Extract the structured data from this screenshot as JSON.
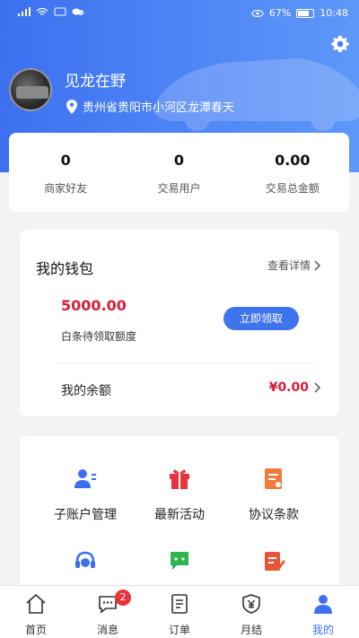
{
  "status_bar": {
    "battery": "67%",
    "time": "10:48"
  },
  "profile": {
    "name": "见龙在野",
    "location": "贵州省贵阳市小河区龙潭春天"
  },
  "stats": [
    {
      "value": "0",
      "label": "商家好友"
    },
    {
      "value": "0",
      "label": "交易用户"
    },
    {
      "value": "0.00",
      "label": "交易总金额"
    }
  ],
  "wallet": {
    "title": "我的钱包",
    "detail_link": "查看详情",
    "credit_amount": "5000.00",
    "credit_label": "白条待领取额度",
    "claim_button": "立即领取",
    "balance_label": "我的余额",
    "balance_value": "¥0.00"
  },
  "menu": {
    "items": [
      {
        "label": "子账户管理",
        "icon": "sub-account-icon"
      },
      {
        "label": "最新活动",
        "icon": "gift-icon"
      },
      {
        "label": "协议条款",
        "icon": "agreement-icon"
      }
    ],
    "second_row_icons": [
      "customer-service-icon",
      "message-chat-icon",
      "edit-document-icon"
    ]
  },
  "tabbar": {
    "items": [
      {
        "label": "首页",
        "icon": "home-icon"
      },
      {
        "label": "消息",
        "icon": "message-icon",
        "badge": "2"
      },
      {
        "label": "订单",
        "icon": "order-icon"
      },
      {
        "label": "月结",
        "icon": "monthly-settlement-icon"
      },
      {
        "label": "我的",
        "icon": "profile-icon",
        "active": true
      }
    ]
  },
  "colors": {
    "primary": "#3d70f0",
    "accent_red": "#d81e34",
    "badge_red": "#e8343c"
  }
}
